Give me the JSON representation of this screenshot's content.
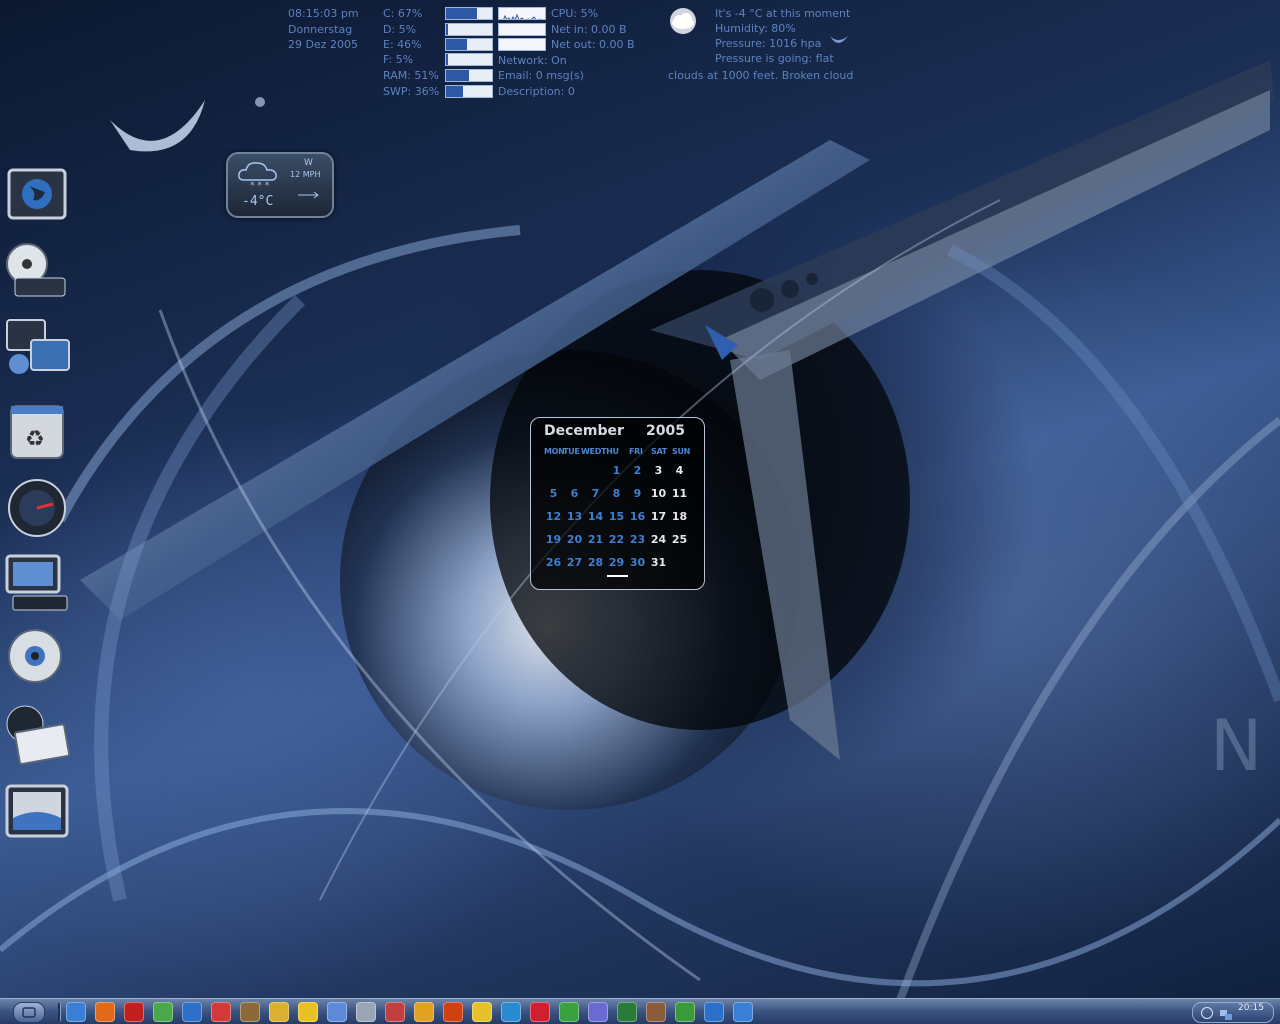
{
  "system_stats": {
    "time": "08:15:03 pm",
    "weekday": "Donnerstag",
    "date": "29 Dez 2005",
    "drives": [
      {
        "label": "C: 67%",
        "value": 67
      },
      {
        "label": "D: 5%",
        "value": 5
      },
      {
        "label": "E: 46%",
        "value": 46
      },
      {
        "label": "F: 5%",
        "value": 5
      },
      {
        "label": "RAM: 51%",
        "value": 51
      },
      {
        "label": "SWP: 36%",
        "value": 36
      }
    ],
    "cpu": "CPU: 5%",
    "net_in": "Net in: 0.00 B",
    "net_out": "Net out: 0.00 B",
    "network": "Network: On",
    "email": "Email: 0 msg(s)",
    "description": "Description: 0"
  },
  "weather_text": {
    "line1": "It's  -4 °C at this moment",
    "line2": "Humidity:   80%",
    "line3": "Pressure:   1016 hpa",
    "line4": "Pressure is going:  flat",
    "line5": "clouds at 1000 feet. Broken cloud"
  },
  "weather_widget": {
    "wind_dir": "W",
    "wind_speed": "12 MPH",
    "temperature": "-4°C"
  },
  "calendar": {
    "month": "December",
    "year": "2005",
    "weekdays": [
      "MON",
      "TUE",
      "WED",
      "THU",
      "FRI",
      "SAT",
      "SUN"
    ],
    "weeks": [
      [
        "",
        "",
        "",
        "1",
        "2",
        "3",
        "4"
      ],
      [
        "5",
        "6",
        "7",
        "8",
        "9",
        "10",
        "11"
      ],
      [
        "12",
        "13",
        "14",
        "15",
        "16",
        "17",
        "18"
      ],
      [
        "19",
        "20",
        "21",
        "22",
        "23",
        "24",
        "25"
      ],
      [
        "26",
        "27",
        "28",
        "29",
        "30",
        "31",
        ""
      ]
    ],
    "today": "29"
  },
  "dock": [
    {
      "name": "internet-icon"
    },
    {
      "name": "cd-drive-icon"
    },
    {
      "name": "network-icon"
    },
    {
      "name": "recycle-bin-icon"
    },
    {
      "name": "world-clock-icon"
    },
    {
      "name": "my-computer-icon"
    },
    {
      "name": "dvd-drive-icon"
    },
    {
      "name": "mail-icon"
    },
    {
      "name": "display-icon"
    }
  ],
  "taskbar": {
    "clock": "20:15",
    "colors": [
      "#3a7fd6",
      "#e06a1a",
      "#c02020",
      "#4aa84a",
      "#2d6fc9",
      "#d23a3a",
      "#8a6a3a",
      "#d9b030",
      "#e8c020",
      "#5c8ad8",
      "#9aa5b5",
      "#c04040",
      "#e0a020",
      "#d04010",
      "#e6c22a",
      "#2a8ad0",
      "#d02030",
      "#3aa040",
      "#6a6ad0",
      "#2a7a3a",
      "#8a5a3a",
      "#3a9a3a",
      "#2a70c8"
    ],
    "icons": [
      "ie-icon",
      "settings-icon",
      "media-icon",
      "messenger-icon",
      "player-icon",
      "paint-icon",
      "folder-icon",
      "winamp-icon",
      "banana-icon",
      "editor-icon",
      "files-icon",
      "scissors-icon",
      "chat-icon",
      "firefox-icon",
      "photo-icon",
      "star-icon",
      "text-icon",
      "strawberry-icon",
      "notes-icon",
      "window-icon",
      "terminal-icon",
      "camera-icon",
      "frog-icon",
      "screen-icon"
    ]
  }
}
